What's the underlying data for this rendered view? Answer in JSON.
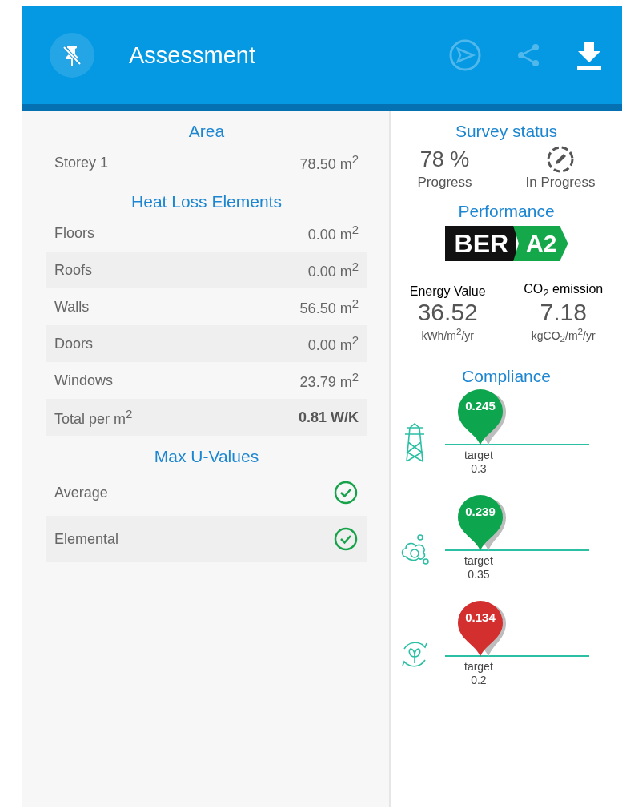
{
  "header": {
    "title": "Assessment",
    "actions": [
      {
        "kind": "send",
        "disabled": true
      },
      {
        "kind": "share",
        "disabled": true
      },
      {
        "kind": "download",
        "disabled": false
      }
    ]
  },
  "area": {
    "title": "Area",
    "rows": [
      {
        "label": "Storey 1",
        "value": "78.50 m$^{2}$"
      }
    ]
  },
  "heat_loss": {
    "title": "Heat Loss Elements",
    "rows": [
      {
        "label": "Floors",
        "value": "0.00 m$^{2}$"
      },
      {
        "label": "Roofs",
        "value": "0.00 m$^{2}$"
      },
      {
        "label": "Walls",
        "value": "56.50 m$^{2}$"
      },
      {
        "label": "Doors",
        "value": "0.00 m$^{2}$"
      },
      {
        "label": "Windows",
        "value": "23.79 m$^{2}$"
      }
    ],
    "total": {
      "label": "Total per m$^{2}$",
      "value": "0.81 W/K"
    }
  },
  "max_u_values": {
    "title": "Max U-Values",
    "rows": [
      {
        "label": "Average",
        "passed": true
      },
      {
        "label": "Elemental",
        "passed": true
      }
    ]
  },
  "survey_status": {
    "title": "Survey status",
    "progress": "78 %",
    "progress_label": "Progress",
    "status_label": "In Progress"
  },
  "performance": {
    "title": "Performance",
    "badge_prefix": "BER",
    "rating": "A2",
    "energy": {
      "label": "Energy Value",
      "value": "36.52",
      "unit": "kWh/m$^{2}$/yr"
    },
    "co2": {
      "label": "CO$_{2}$ emission",
      "value": "7.18",
      "unit": "kgCO$_{2}$/m$^{2}$/yr"
    }
  },
  "compliance": {
    "title": "Compliance",
    "items": [
      {
        "kind": "pylon",
        "value": "0.245",
        "color": "#0da54d",
        "target_label": "target",
        "target": "0.3"
      },
      {
        "kind": "co2",
        "value": "0.239",
        "color": "#0da54d",
        "target_label": "target",
        "target": "0.35"
      },
      {
        "kind": "leaf",
        "value": "0.134",
        "color": "#d32f2f",
        "target_label": "target",
        "target": "0.2"
      }
    ]
  }
}
